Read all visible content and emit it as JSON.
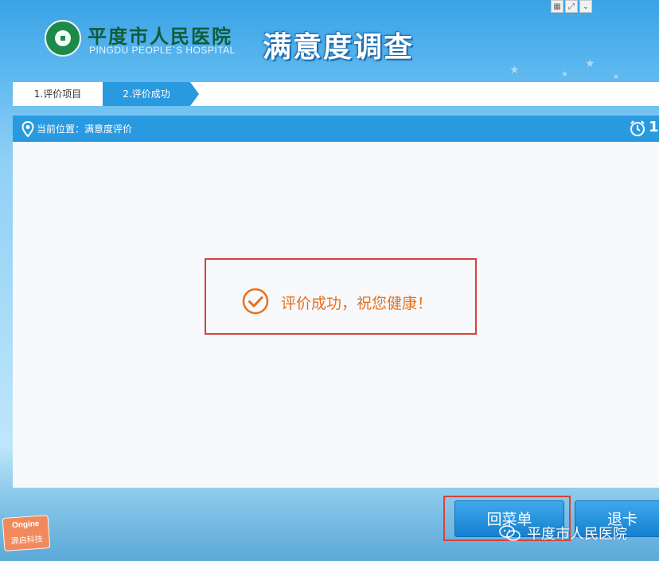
{
  "header": {
    "hospital_name_cn": "平度市人民医院",
    "hospital_name_en": "PINGDU PEOPLE`S HOSPITAL",
    "app_title": "满意度调查"
  },
  "steps": [
    {
      "label": "1.评价项目",
      "active": false
    },
    {
      "label": "2.评价成功",
      "active": true
    }
  ],
  "panel": {
    "location_text": "当前位置：满意度评价",
    "timer_text": "1"
  },
  "result": {
    "message": "评价成功，祝您健康！",
    "color": "#e8701a"
  },
  "buttons": {
    "menu_label": "回菜单",
    "exit_label": "退卡"
  },
  "brand": {
    "name_en": "Ongine",
    "name_cn": "源启科技"
  },
  "watermark": {
    "text": "平度市人民医院"
  },
  "colors": {
    "accent": "#2a9ae0",
    "highlight_border": "#d9413a"
  }
}
